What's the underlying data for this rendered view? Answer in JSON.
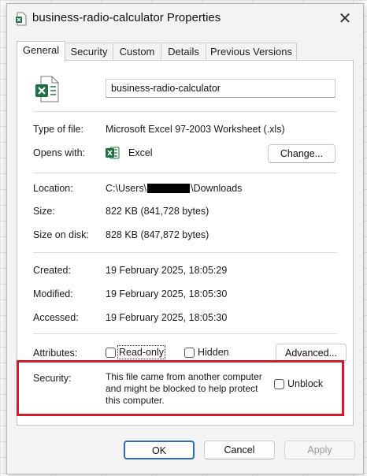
{
  "window": {
    "title": "business-radio-calculator Properties",
    "close_glyph": "✕"
  },
  "tabs": [
    "General",
    "Security",
    "Custom",
    "Details",
    "Previous Versions"
  ],
  "file_name": "business-radio-calculator",
  "type_of_file": {
    "label": "Type of file:",
    "value": "Microsoft Excel 97-2003 Worksheet (.xls)"
  },
  "opens_with": {
    "label": "Opens with:",
    "app": "Excel",
    "change_label": "Change..."
  },
  "location": {
    "label": "Location:",
    "prefix": "C:\\Users\\",
    "suffix": "\\Downloads"
  },
  "size": {
    "label": "Size:",
    "value": "822 KB (841,728 bytes)"
  },
  "size_on_disk": {
    "label": "Size on disk:",
    "value": "828 KB (847,872 bytes)"
  },
  "created": {
    "label": "Created:",
    "value": "19 February 2025, 18:05:29"
  },
  "modified": {
    "label": "Modified:",
    "value": "19 February 2025, 18:05:30"
  },
  "accessed": {
    "label": "Accessed:",
    "value": "19 February 2025, 18:05:30"
  },
  "attributes": {
    "label": "Attributes:",
    "read_only": "Read-only",
    "hidden": "Hidden",
    "advanced_label": "Advanced..."
  },
  "security": {
    "label": "Security:",
    "message": "This file came from another computer and might be blocked to help protect this computer.",
    "unblock_label": "Unblock"
  },
  "buttons": {
    "ok": "OK",
    "cancel": "Cancel",
    "apply": "Apply"
  },
  "colors": {
    "highlight": "#d11a2a",
    "excel_green": "#1e7145",
    "ok_border": "#2b6cc4"
  },
  "icons": {
    "title": "excel-file-icon",
    "file": "excel-file-icon",
    "app": "excel-icon",
    "close": "close-icon"
  }
}
